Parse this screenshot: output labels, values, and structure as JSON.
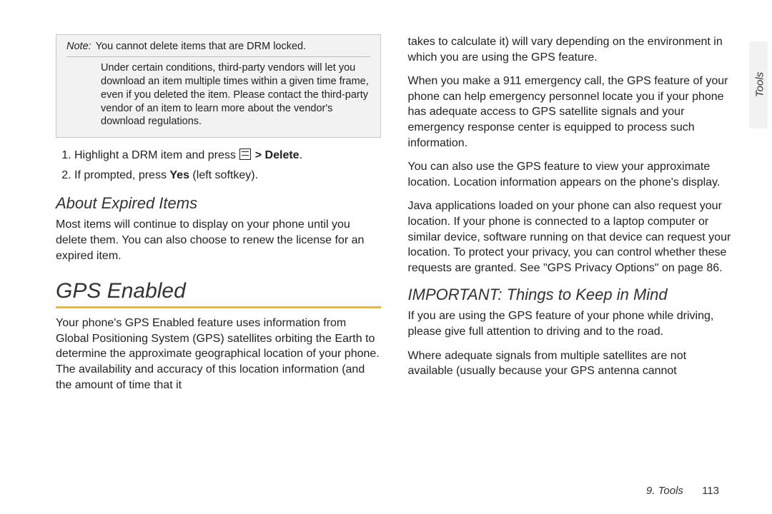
{
  "left": {
    "note": {
      "label": "Note:",
      "top": "You cannot delete items that are DRM locked.",
      "body": "Under certain conditions, third-party vendors will let you download an item multiple times within a given time frame, even if you deleted the item. Please contact the third-party vendor of an item to learn more about the vendor's download regulations."
    },
    "steps": {
      "s1_pre": "Highlight a DRM item and press ",
      "s1_sep": " > ",
      "s1_bold": "Delete",
      "s1_end": ".",
      "s2_pre": "If prompted, press ",
      "s2_bold": "Yes",
      "s2_post": " (left softkey)."
    },
    "h_expired": "About Expired Items",
    "p_expired": "Most items will continue to display on your phone until you delete them. You can also choose to renew the license for an expired item.",
    "h_gps": "GPS Enabled",
    "p_gps": "Your phone's GPS Enabled feature uses information from Global Positioning System (GPS) satellites orbiting the Earth to determine the approximate geographical location of your phone. The availability and accuracy of this location information (and the amount of time that it"
  },
  "right": {
    "p1": "takes to calculate it) will vary depending on the environment in which you are using the GPS feature.",
    "p2": "When you make a 911 emergency call, the GPS feature of your phone can help emergency personnel locate you if your phone has adequate access to GPS satellite signals and your emergency response center is equipped to process such information.",
    "p3": "You can also use the GPS feature to view your approximate location. Location information appears on the phone's display.",
    "p4": "Java applications loaded on your phone can also request your location. If your phone is connected to a laptop computer or similar device, software running on that device can request your location. To protect your privacy, you can control whether these requests are granted. See \"GPS Privacy Options\" on page 86.",
    "h_important": "IMPORTANT: Things to Keep in Mind",
    "p5": "If you are using the GPS feature of your phone while driving, please give full attention to driving and to the road.",
    "p6": "Where adequate signals from multiple satellites are not available (usually because your GPS antenna cannot"
  },
  "sideTab": "Tools",
  "footer": {
    "chapter": "9. Tools",
    "page": "113"
  }
}
